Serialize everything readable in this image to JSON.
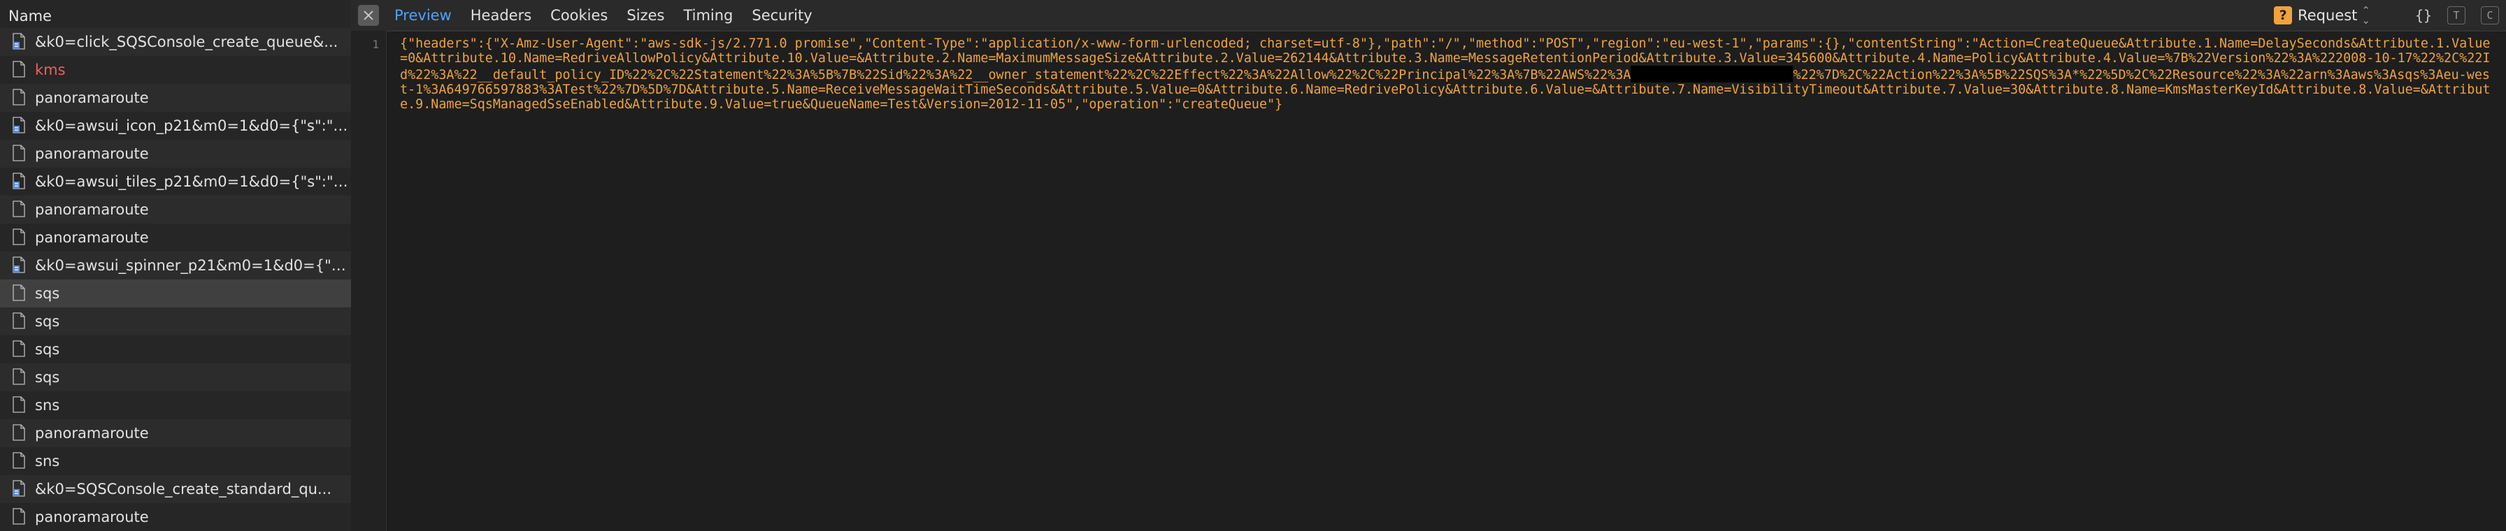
{
  "sidebar": {
    "header": "Name",
    "rows": [
      {
        "name": "&k0=click_SQSConsole_create_queue&...",
        "icon": "script-file-icon",
        "style": "alt"
      },
      {
        "name": "kms",
        "icon": "file-icon",
        "style": "err"
      },
      {
        "name": "panoramaroute",
        "icon": "file-icon",
        "style": "alt"
      },
      {
        "name": "&k0=awsui_icon_p21&m0=1&d0={\"s\":\"i...",
        "icon": "script-file-icon",
        "style": ""
      },
      {
        "name": "panoramaroute",
        "icon": "file-icon",
        "style": "alt"
      },
      {
        "name": "&k0=awsui_tiles_p21&m0=1&d0={\"s\":\"t...",
        "icon": "script-file-icon",
        "style": ""
      },
      {
        "name": "panoramaroute",
        "icon": "file-icon",
        "style": "alt"
      },
      {
        "name": "panoramaroute",
        "icon": "file-icon",
        "style": ""
      },
      {
        "name": "&k0=awsui_spinner_p21&m0=1&d0={\"s...",
        "icon": "script-file-icon",
        "style": "alt"
      },
      {
        "name": "sqs",
        "icon": "file-icon",
        "style": "sel"
      },
      {
        "name": "sqs",
        "icon": "file-icon",
        "style": "alt"
      },
      {
        "name": "sqs",
        "icon": "file-icon",
        "style": ""
      },
      {
        "name": "sqs",
        "icon": "file-icon",
        "style": "alt"
      },
      {
        "name": "sns",
        "icon": "file-icon",
        "style": ""
      },
      {
        "name": "panoramaroute",
        "icon": "file-icon",
        "style": "alt"
      },
      {
        "name": "sns",
        "icon": "file-icon",
        "style": ""
      },
      {
        "name": "&k0=SQSConsole_create_standard_qu...",
        "icon": "script-file-icon",
        "style": "alt"
      },
      {
        "name": "panoramaroute",
        "icon": "file-icon",
        "style": ""
      }
    ]
  },
  "tabs": [
    "Preview",
    "Headers",
    "Cookies",
    "Sizes",
    "Timing",
    "Security"
  ],
  "active_tab": "Preview",
  "toolbar": {
    "badge": "?",
    "select_label": "Request",
    "tool_braces": "{}",
    "tool_t": "T",
    "tool_c": "C"
  },
  "code": {
    "line_number": "1",
    "text_before_redaction": "{\"headers\":{\"X-Amz-User-Agent\":\"aws-sdk-js/2.771.0 promise\",\"Content-Type\":\"application/x-www-form-urlencoded; charset=utf-8\"},\"path\":\"/\",\"method\":\"POST\",\"region\":\"eu-west-1\",\"params\":{},\"contentString\":\"Action=CreateQueue&Attribute.1.Name=DelaySeconds&Attribute.1.Value=0&Attribute.10.Name=RedriveAllowPolicy&Attribute.10.Value=&Attribute.2.Name=MaximumMessageSize&Attribute.2.Value=262144&Attribute.3.Name=MessageRetentionPeriod&Attribute.3.Value=345600&Attribute.4.Name=Policy&Attribute.4.Value=%7B%22Version%22%3A%222008-10-17%22%2C%22Id%22%3A%22__default_policy_ID%22%2C%22Statement%22%3A%5B%7B%22Sid%22%3A%22__owner_statement%22%2C%22Effect%22%3A%22Allow%22%2C%22Principal%22%3A%7B%22AWS%22%3A",
    "text_after_redaction": "%22%7D%2C%22Action%22%3A%5B%22SQS%3A*%22%5D%2C%22Resource%22%3A%22arn%3Aaws%3Asqs%3Aeu-west-1%3A649766597883%3ATest%22%7D%5D%7D&Attribute.5.Name=ReceiveMessageWaitTimeSeconds&Attribute.5.Value=0&Attribute.6.Name=RedrivePolicy&Attribute.6.Value=&Attribute.7.Name=VisibilityTimeout&Attribute.7.Value=30&Attribute.8.Name=KmsMasterKeyId&Attribute.8.Value=&Attribute.9.Name=SqsManagedSseEnabled&Attribute.9.Value=true&QueueName=Test&Version=2012-11-05\",\"operation\":\"createQueue\"}"
  },
  "colors": {
    "accent": "#4ea1ff",
    "string": "#f0a33a",
    "error": "#f0605a",
    "badge": "#f2a23a"
  }
}
